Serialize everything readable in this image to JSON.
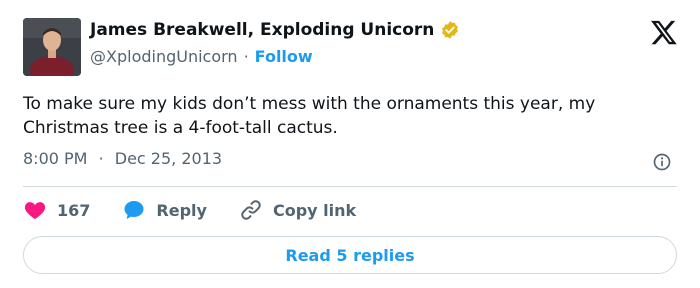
{
  "author": {
    "display_name": "James Breakwell, Exploding Unicorn",
    "handle": "@XplodingUnicorn",
    "separator": "·",
    "follow_label": "Follow",
    "verified_badge_icon": "gold-verified-badge-icon",
    "avatar_icon": "profile-photo"
  },
  "tweet": {
    "text": "To make sure my kids don’t mess with the ornaments this year, my Christmas tree is a 4-foot-tall cactus.",
    "time": "8:00 PM",
    "separator": "·",
    "date": "Dec 25, 2013"
  },
  "actions": {
    "like_count": "167",
    "reply_label": "Reply",
    "copy_link_label": "Copy link"
  },
  "footer": {
    "read_replies_label": "Read 5 replies"
  },
  "colors": {
    "text_primary": "#0f1419",
    "text_secondary": "#536471",
    "link_blue": "#1d9bf0",
    "like_pink": "#f91880",
    "divider": "#cfd9de",
    "verified_gold": "#e2b719"
  },
  "icons": [
    "x-logo-icon",
    "verified-badge-icon",
    "info-icon",
    "heart-icon",
    "reply-bubble-icon",
    "link-icon"
  ]
}
